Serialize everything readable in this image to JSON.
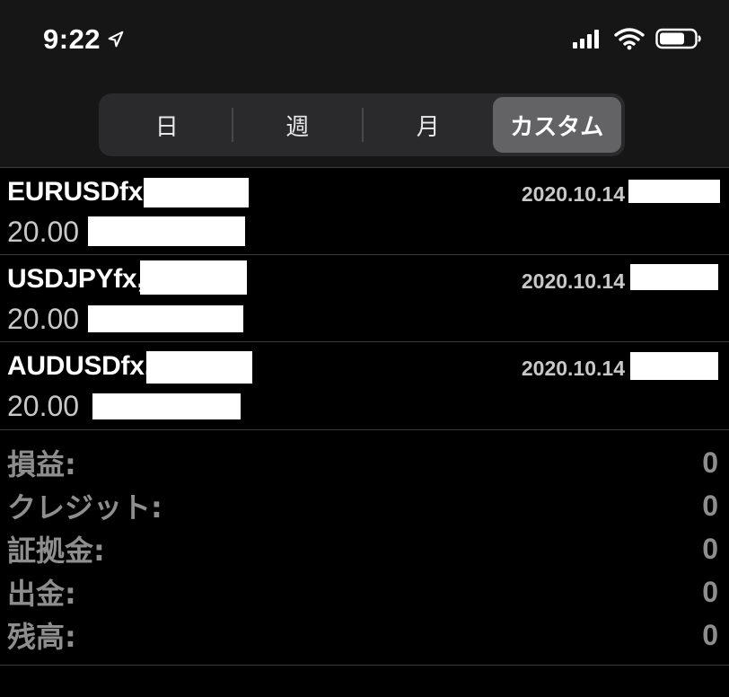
{
  "status_bar": {
    "time": "9:22"
  },
  "segments": [
    {
      "label": "日",
      "selected": false
    },
    {
      "label": "週",
      "selected": false
    },
    {
      "label": "月",
      "selected": false
    },
    {
      "label": "カスタム",
      "selected": true
    }
  ],
  "orders": [
    {
      "symbol": "EURUSDfx,",
      "volume": "20.00",
      "date": "2020.10.14"
    },
    {
      "symbol": "USDJPYfx,",
      "volume": "20.00",
      "date": "2020.10.14"
    },
    {
      "symbol": "AUDUSDfx,",
      "volume": "20.00",
      "date": "2020.10.14"
    }
  ],
  "summary": [
    {
      "label": "損益:",
      "value": "0"
    },
    {
      "label": "クレジット:",
      "value": "0"
    },
    {
      "label": "証拠金:",
      "value": "0"
    },
    {
      "label": "出金:",
      "value": "0"
    },
    {
      "label": "残高:",
      "value": "0"
    }
  ],
  "colors": {
    "background": "#000000",
    "header": "#161616",
    "segment_bg": "#2a2a2c",
    "segment_active": "#636366",
    "text_primary": "#ffffff",
    "text_secondary": "#c8c8c8",
    "text_muted": "#8e8e8e",
    "divider": "#3a3a3a"
  }
}
